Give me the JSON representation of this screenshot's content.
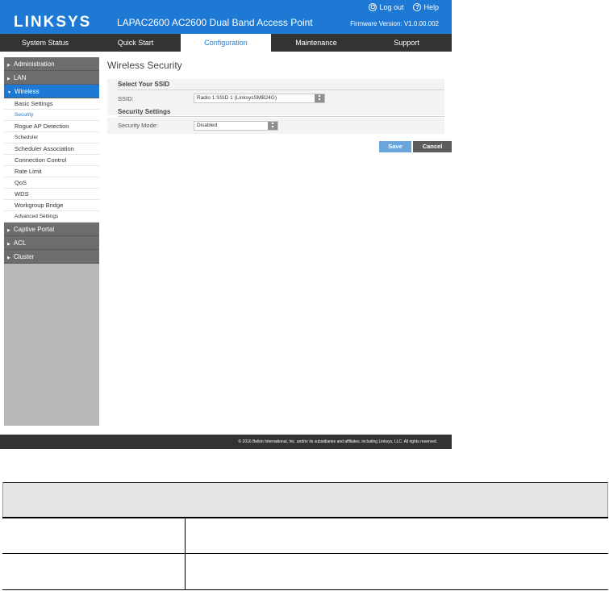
{
  "header": {
    "logo": "LINKSYS",
    "product_title": "LAPAC2600 AC2600 Dual Band Access Point",
    "logout_label": "Log out",
    "help_label": "Help",
    "firmware": "Firmware Version: V1.0.00.002"
  },
  "nav": {
    "tabs": [
      {
        "label": "System Status"
      },
      {
        "label": "Quick Start"
      },
      {
        "label": "Configuration",
        "active": true
      },
      {
        "label": "Maintenance"
      },
      {
        "label": "Support"
      }
    ]
  },
  "sidebar": {
    "groups": [
      {
        "label": "Administration"
      },
      {
        "label": "LAN"
      },
      {
        "label": "Wireless",
        "open": true
      },
      {
        "label": "Captive Portal"
      },
      {
        "label": "ACL"
      },
      {
        "label": "Cluster"
      }
    ],
    "wireless_items": [
      {
        "label": "Basic Settings"
      },
      {
        "label": "Security",
        "active": true
      },
      {
        "label": "Rogue AP Detection"
      },
      {
        "label": "Scheduler"
      },
      {
        "label": "Scheduler Association"
      },
      {
        "label": "Connection Control"
      },
      {
        "label": "Rate Limit"
      },
      {
        "label": "QoS"
      },
      {
        "label": "WDS"
      },
      {
        "label": "Workgroup Bridge"
      },
      {
        "label": "Advanced Settings"
      }
    ]
  },
  "main": {
    "page_title": "Wireless Security",
    "select_ssid_heading": "Select Your SSID",
    "ssid_label": "SSID:",
    "ssid_value": "Radio 1:SSID 1 (LinksysSMB24G)",
    "security_heading": "Security Settings",
    "security_mode_label": "Security Mode:",
    "security_mode_value": "Disabled",
    "save_label": "Save",
    "cancel_label": "Cancel"
  },
  "footer": {
    "copyright": "© 2016 Belkin International, Inc. and/or its subsidiaries and affiliates, including Linksys, LLC. All rights reserved."
  },
  "colors": {
    "brand_blue": "#1d79d3",
    "nav_dark": "#333333",
    "sidebar_gray": "#b8b8b8"
  }
}
